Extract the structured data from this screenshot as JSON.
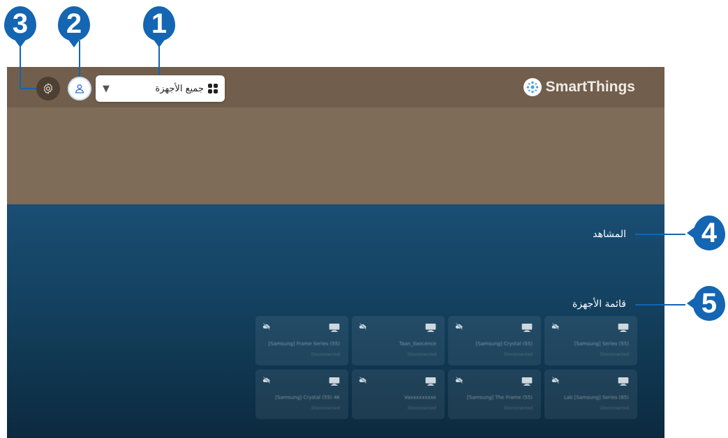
{
  "callouts": [
    "1",
    "2",
    "3",
    "4",
    "5"
  ],
  "header": {
    "dropdown_label": "جميع الأجهزة",
    "brand": "SmartThings"
  },
  "sections": {
    "scenes": "المشاهد",
    "device_list": "قائمة الأجهزة"
  },
  "devices": [
    {
      "name": "[Samsung] Frame Series (55)",
      "status": "Disconnected",
      "icon": "tv-icon",
      "badge": "cloud-off-icon"
    },
    {
      "name": "Taan_Ilaocence",
      "status": "Disconnected",
      "icon": "tv-icon",
      "badge": "cloud-off-icon"
    },
    {
      "name": "[Samsung] Crystal (55)",
      "status": "Disconnected",
      "icon": "tv-icon",
      "badge": "cloud-off-icon"
    },
    {
      "name": "[Samsung] Series (55)",
      "status": "Disconnected",
      "icon": "tv-icon",
      "badge": "cloud-off-icon"
    },
    {
      "name": "[Samsung] Crystal (55) 4K",
      "status": "Disconnected",
      "icon": "tv-icon",
      "badge": "cloud-off-icon"
    },
    {
      "name": "Vaxxxxxxxxe",
      "status": "Disconnected",
      "icon": "tv-icon",
      "badge": "cloud-off-icon"
    },
    {
      "name": "[Samsung] The Frame (55)",
      "status": "Disconnected",
      "icon": "tv-icon",
      "badge": "cloud-off-icon"
    },
    {
      "name": "Lab [Samsung] Series (65)",
      "status": "Disconnected",
      "icon": "tv-icon",
      "badge": "cloud-off-icon"
    }
  ],
  "colors": {
    "callout": "#1465b2",
    "header_bg": "#7e6b58",
    "main_bg": "#13405e"
  }
}
